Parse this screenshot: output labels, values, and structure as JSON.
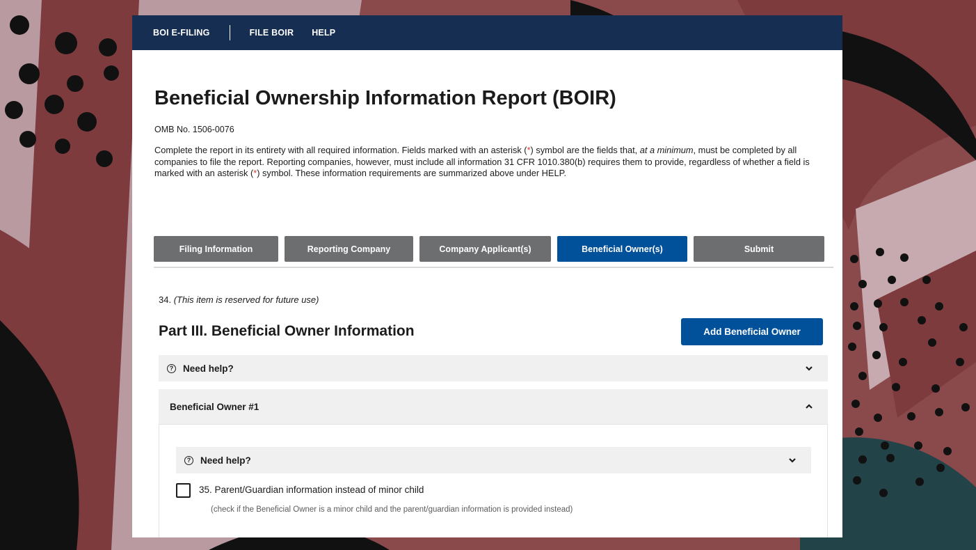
{
  "nav": {
    "items": [
      "BOI E-FILING",
      "FILE BOIR",
      "HELP"
    ]
  },
  "page": {
    "title": "Beneficial Ownership Information Report (BOIR)",
    "omb": "OMB No. 1506-0076",
    "intro_parts": [
      "Complete the report in its entirety with all required information. Fields marked with an asterisk (",
      "*",
      ") symbol are the fields that, ",
      "at a minimum",
      ", must be completed by all companies to file the report. Reporting companies, however, must include all information 31 CFR 1010.380(b) requires them to provide, regardless of whether a field is marked with an asterisk (",
      "*",
      ") symbol. These information requirements are summarized above under HELP."
    ]
  },
  "tabs": [
    {
      "label": "Filing Information"
    },
    {
      "label": "Reporting Company"
    },
    {
      "label": "Company Applicant(s)"
    },
    {
      "label": "Beneficial Owner(s)",
      "active": true
    },
    {
      "label": "Submit"
    }
  ],
  "section": {
    "reserved_number": "34.",
    "reserved_text": "(This item is reserved for future use)",
    "heading": "Part III. Beneficial Owner Information",
    "add_button": "Add Beneficial Owner",
    "help_label": "Need help?",
    "owner_title": "Beneficial Owner #1",
    "inner_help_label": "Need help?",
    "checkbox_label": "35. Parent/Guardian information instead of minor child",
    "checkbox_hint": "(check if the Beneficial Owner is a minor child and the parent/guardian information is provided instead)",
    "checkbox_checked": false
  },
  "icons": {
    "help": "question-circle-icon",
    "expand": "chevron-down-icon",
    "collapse": "chevron-up-icon"
  },
  "colors": {
    "navbar": "#162e51",
    "primary": "#00509a",
    "tab_inactive": "#6d6e70",
    "required_asterisk": "#d83933",
    "background": "#8a4a4c"
  }
}
